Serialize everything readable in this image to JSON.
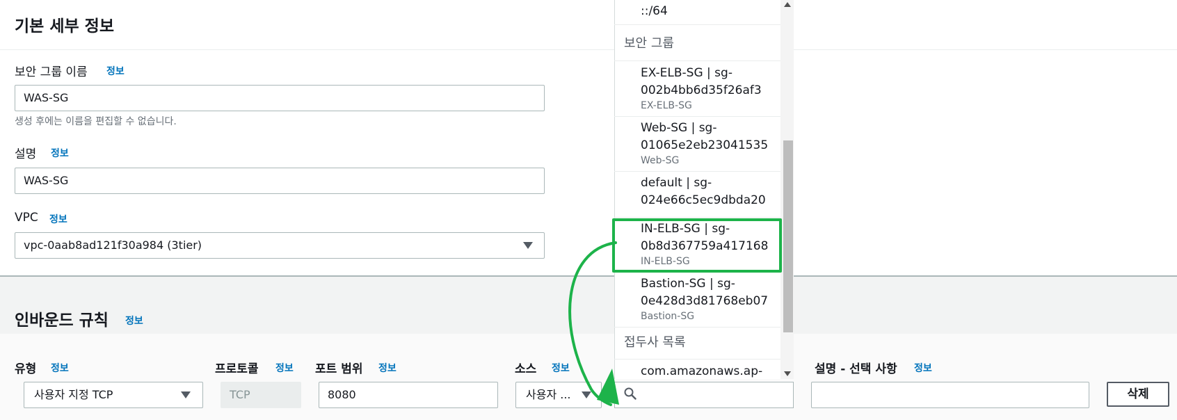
{
  "details": {
    "title": "기본 세부 정보",
    "info": "정보",
    "sg_name_label": "보안 그룹 이름",
    "sg_name_value": "WAS-SG",
    "sg_name_hint": "생성 후에는 이름을 편집할 수 없습니다.",
    "desc_label": "설명",
    "desc_value": "WAS-SG",
    "vpc_label": "VPC",
    "vpc_value": "vpc-0aab8ad121f30a984 (3tier)"
  },
  "inbound": {
    "title": "인바운드 규칙",
    "info": "정보",
    "type_label": "유형",
    "type_value": "사용자 지정 TCP",
    "protocol_label": "프로토콜",
    "protocol_value": "TCP",
    "port_label": "포트 범위",
    "port_value": "8080",
    "source_label": "소스",
    "source_value": "사용자 ...",
    "desc_label": "설명 - 선택 사항",
    "desc_value": "",
    "delete_button": "삭제"
  },
  "dropdown": {
    "top_item": "::/64",
    "group_sg": "보안 그룹",
    "items": [
      {
        "line1": "EX-ELB-SG | sg-",
        "line2": "002b4bb6d35f26af3",
        "sub": "EX-ELB-SG"
      },
      {
        "line1": "Web-SG | sg-",
        "line2": "01065e2eb23041535",
        "sub": "Web-SG"
      },
      {
        "line1": "default | sg-",
        "line2": "024e66c5ec9dbda20",
        "sub": ""
      },
      {
        "line1": "IN-ELB-SG | sg-",
        "line2": "0b8d367759a417168",
        "sub": "IN-ELB-SG"
      },
      {
        "line1": "Bastion-SG | sg-",
        "line2": "0e428d3d81768eb07",
        "sub": "Bastion-SG"
      }
    ],
    "group_prefix": "접두사 목록",
    "prefix_item": "com.amazonaws.ap-",
    "search_value": ""
  },
  "colors": {
    "highlight": "#1db34a",
    "link": "#0073bb"
  }
}
